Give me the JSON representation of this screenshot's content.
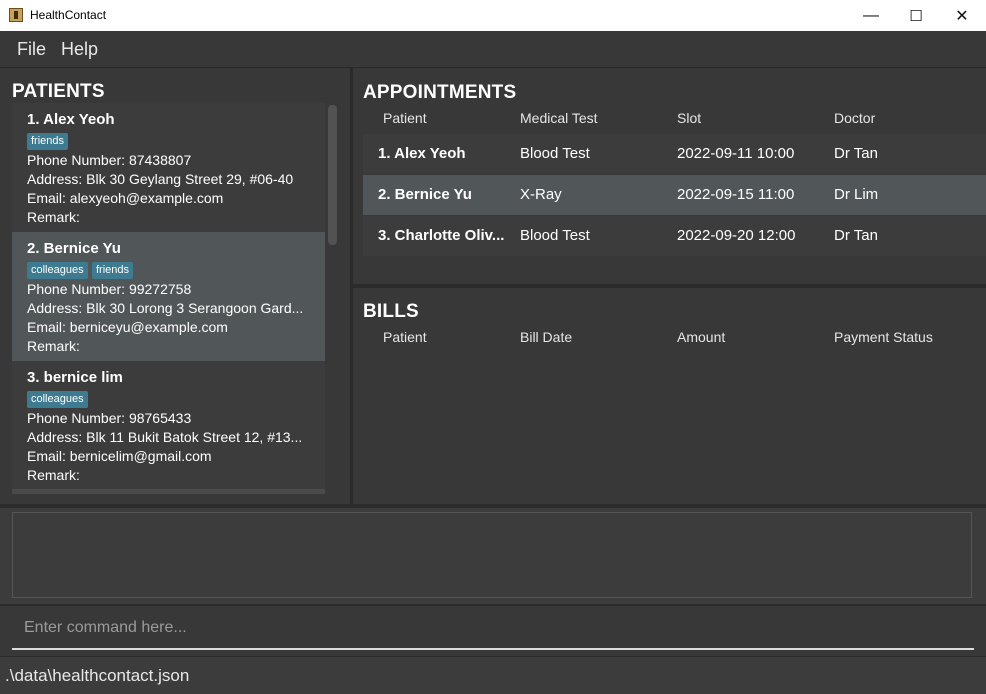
{
  "window": {
    "title": "HealthContact",
    "minimize": "—",
    "maximize": "☐",
    "close": "✕"
  },
  "menu": {
    "items": [
      "File",
      "Help"
    ]
  },
  "patients": {
    "title": "PATIENTS",
    "cards": [
      {
        "name": "1.  Alex Yeoh",
        "tags": [
          "friends"
        ],
        "phone": "Phone Number: 87438807",
        "address": "Address: Blk 30 Geylang Street 29, #06-40",
        "email": "Email: alexyeoh@example.com",
        "remark": "Remark:"
      },
      {
        "name": "2.  Bernice Yu",
        "tags": [
          "colleagues",
          "friends"
        ],
        "phone": "Phone Number: 99272758",
        "address": "Address: Blk 30 Lorong 3 Serangoon Gard...",
        "email": "Email: berniceyu@example.com",
        "remark": "Remark:"
      },
      {
        "name": "3.  bernice lim",
        "tags": [
          "colleagues"
        ],
        "phone": "Phone Number: 98765433",
        "address": "Address: Blk 11 Bukit Batok Street 12, #13...",
        "email": "Email: bernicelim@gmail.com",
        "remark": "Remark:"
      }
    ]
  },
  "appointments": {
    "title": "APPOINTMENTS",
    "columns": [
      "Patient",
      "Medical Test",
      "Slot",
      "Doctor"
    ],
    "rows": [
      {
        "patient": "1.  Alex Yeoh",
        "test": "Blood Test",
        "slot": "2022-09-11 10:00",
        "doctor": "Dr Tan"
      },
      {
        "patient": "2.  Bernice Yu",
        "test": "X-Ray",
        "slot": "2022-09-15 11:00",
        "doctor": "Dr Lim"
      },
      {
        "patient": "3.  Charlotte Oliv...",
        "test": "Blood Test",
        "slot": "2022-09-20 12:00",
        "doctor": "Dr Tan"
      }
    ]
  },
  "bills": {
    "title": "BILLS",
    "columns": [
      "Patient",
      "Bill Date",
      "Amount",
      "Payment Status"
    ]
  },
  "command": {
    "placeholder": "Enter command here..."
  },
  "status": {
    "path": ".\\data\\healthcontact.json"
  },
  "colors": {
    "tag": "#3e7b91",
    "selected": "#515658",
    "background": "#383838"
  }
}
